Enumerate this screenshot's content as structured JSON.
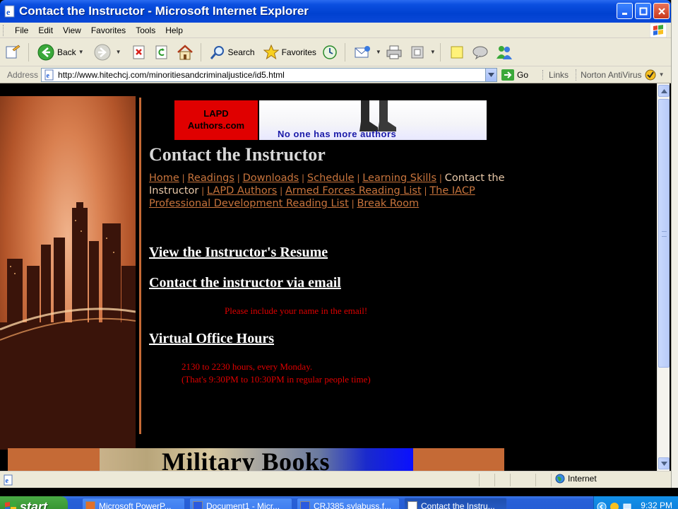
{
  "window": {
    "title": "Contact the Instructor - Microsoft Internet Explorer"
  },
  "menubar": {
    "items": [
      "File",
      "Edit",
      "View",
      "Favorites",
      "Tools",
      "Help"
    ]
  },
  "toolbar": {
    "back_label": "Back",
    "search_label": "Search",
    "favorites_label": "Favorites"
  },
  "addressbar": {
    "label": "Address",
    "url": "http://www.hitechcj.com/minoritiesandcriminaljustice/id5.html",
    "go_label": "Go",
    "links_label": "Links",
    "norton_label": "Norton AntiVirus"
  },
  "page": {
    "banner": {
      "logo_line1": "LAPD",
      "logo_line2": "Authors.com",
      "tagline": "No one has more authors"
    },
    "title": "Contact the Instructor",
    "nav": [
      {
        "label": "Home",
        "current": false
      },
      {
        "label": "Readings",
        "current": false
      },
      {
        "label": "Downloads",
        "current": false
      },
      {
        "label": "Schedule",
        "current": false
      },
      {
        "label": "Learning Skills",
        "current": false
      },
      {
        "label": "Contact the Instructor",
        "current": true
      },
      {
        "label": "LAPD Authors",
        "current": false
      },
      {
        "label": "Armed Forces Reading List",
        "current": false
      },
      {
        "label": "The IACP Professional Development Reading List",
        "current": false
      },
      {
        "label": "Break Room",
        "current": false
      }
    ],
    "resume_link": "View the Instructor's Resume",
    "email_link": "Contact the instructor via email",
    "email_note": "Please include your name in the email!",
    "office_hours_link": "Virtual Office Hours",
    "hours_line1": "2130 to 2230 hours, every Monday.",
    "hours_line2": "(That's 9:30PM to 10:30PM in regular people time)",
    "bottom_banner": "Military Books"
  },
  "statusbar": {
    "zone": "Internet"
  },
  "taskbar": {
    "start_label": "start",
    "tasks": [
      {
        "label": "Microsoft PowerP...",
        "active": false
      },
      {
        "label": "Document1 - Micr...",
        "active": false
      },
      {
        "label": "CRJ385.sylabuss.f...",
        "active": false
      },
      {
        "label": "Contact the Instru...",
        "active": true
      }
    ],
    "clock": "9:32 PM"
  },
  "colors": {
    "nav_link": "#c8743c",
    "note_red": "#e00000",
    "xp_blue": "#0041d0"
  }
}
